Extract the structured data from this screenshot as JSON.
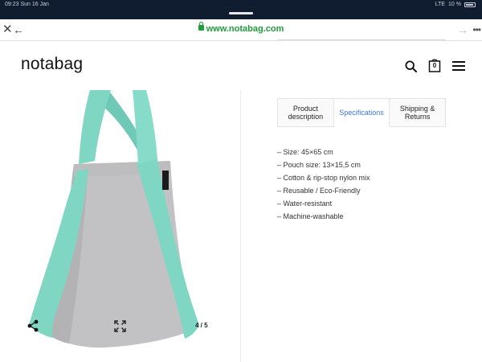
{
  "status_bar": {
    "time": "09:23 Sun 16 Jan",
    "network": "LTE",
    "battery": "10 %"
  },
  "browser": {
    "url": "www.notabag.com"
  },
  "header": {
    "logo": "notabag",
    "cart_count": "0"
  },
  "gallery": {
    "counter": "4 / 5",
    "colors": {
      "bag": "#c2c2c4",
      "strap": "#7fd6c3"
    }
  },
  "tabs": [
    {
      "label": "Product description",
      "active": false
    },
    {
      "label": "Specifications",
      "active": true
    },
    {
      "label": "Shipping & Returns",
      "active": false
    }
  ],
  "specifications": [
    "– Size: 45×65 cm",
    "– Pouch size: 13×15,5 cm",
    "– Cotton & rip-stop nylon mix",
    "– Reusable / Eco-Friendly",
    "– Water-resistant",
    "– Machine-washable"
  ],
  "colors": {
    "accent": "#3b78d6",
    "url_green": "#1f9d3a",
    "status_bar": "#101d31"
  }
}
